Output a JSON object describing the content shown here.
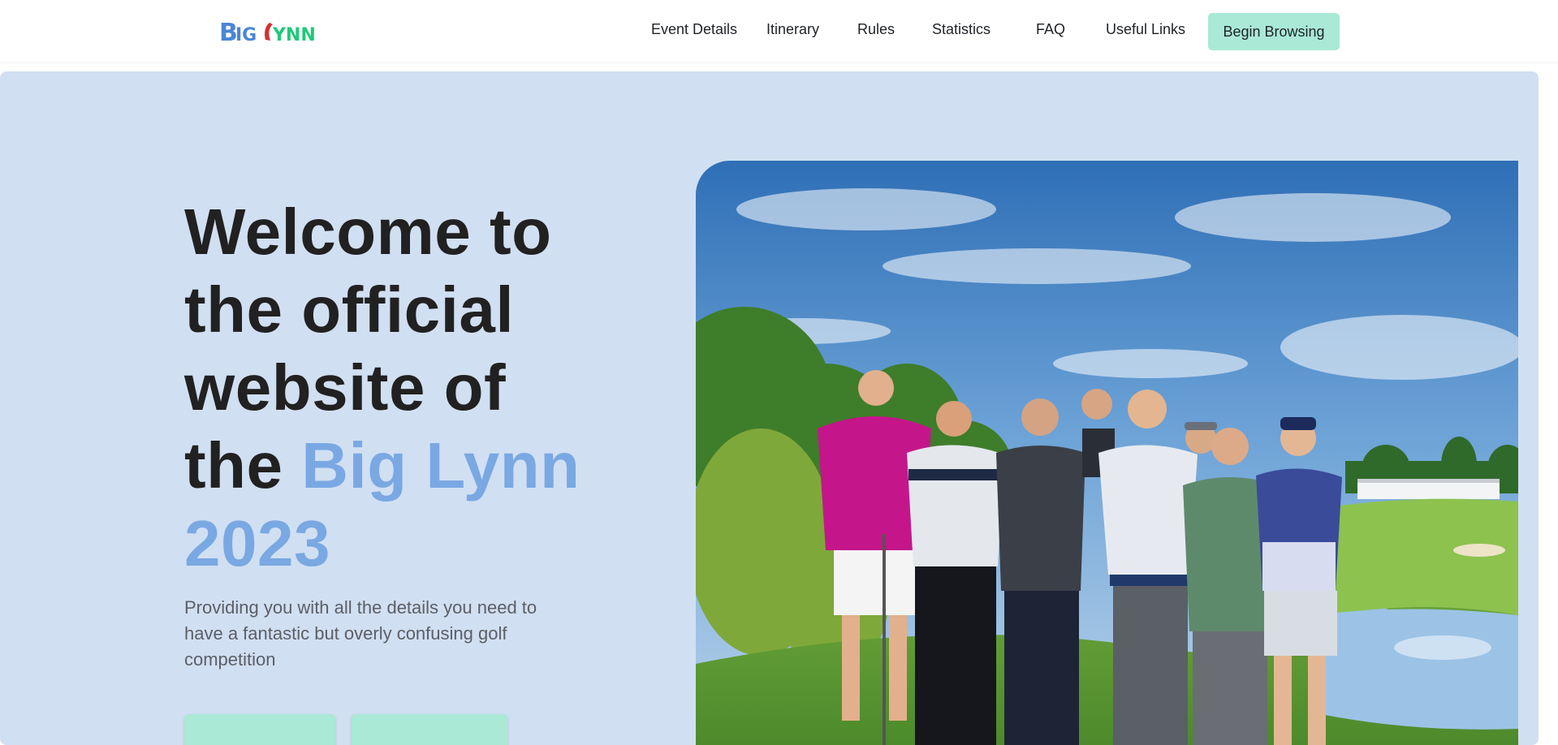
{
  "brand": {
    "logo_big": "BIG",
    "logo_lynn": "LYNN",
    "colors": {
      "big": "#4a86d6",
      "lynn": "#1fc97a",
      "flag": "#cf3434"
    }
  },
  "nav": {
    "links": [
      "Event Details",
      "Itinerary",
      "Rules",
      "Statistics",
      "FAQ",
      "Useful Links"
    ],
    "cta_label": "Begin Browsing"
  },
  "hero": {
    "title_line1": "Welcome to",
    "title_line2": "the official",
    "title_line3": "website of",
    "title_line4_prefix": "the ",
    "title_highlight_1": "Big Lynn",
    "title_highlight_2": "2023",
    "subtitle": "Providing you with all the details you need to have a fantastic but overly confusing golf competition",
    "buttons": [
      "",
      ""
    ]
  },
  "photo": {
    "subject": "group-of-golfers-photo"
  },
  "colors": {
    "accent": "#79a8e3",
    "hero_bg": "#d1dff2",
    "button": "#a9e9d6"
  }
}
